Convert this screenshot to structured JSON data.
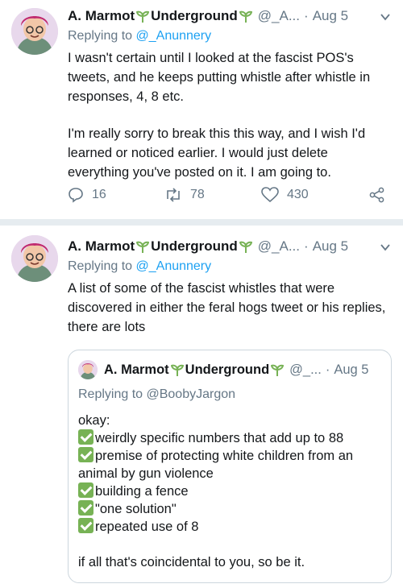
{
  "tweets": [
    {
      "author": {
        "name": "A. Marmot",
        "name_suffix": "Underground",
        "handle": "@_A...",
        "date": "Aug 5"
      },
      "reply_label": "Replying to",
      "reply_to": "@_Anunnery",
      "body": [
        "I wasn't certain until I looked at the fascist POS's tweets, and he keeps putting whistle after whistle in responses, 4, 8 etc.",
        "I'm really sorry to break this this way, and I wish I'd learned or noticed earlier.  I would just delete everything you've posted on it. I am going to."
      ],
      "stats": {
        "replies": "16",
        "retweets": "78",
        "likes": "430"
      }
    },
    {
      "author": {
        "name": "A. Marmot",
        "name_suffix": "Underground",
        "handle": "@_A...",
        "date": "Aug 5"
      },
      "reply_label": "Replying to",
      "reply_to": "@_Anunnery",
      "body": [
        "A list of some of the fascist whistles that were discovered in either the feral hogs tweet or his replies, there are lots"
      ],
      "quote": {
        "author": {
          "name": "A. Marmot",
          "name_suffix": "Underground",
          "handle": "@_...",
          "date": "Aug 5"
        },
        "reply_text": "Replying to @BoobyJargon",
        "intro": "okay:",
        "items": [
          "weirdly specific numbers that add up to 88",
          "premise of protecting white children from an animal by gun violence",
          "building a fence",
          "\"one solution\"",
          "repeated use of 8"
        ],
        "outro": "if all that's coincidental to you, so be it."
      }
    }
  ],
  "colors": {
    "accent": "#1da1f2",
    "secondary_text": "#657786",
    "check": "#77b255",
    "sprout": "#77b255",
    "divider": "#e6ecf0"
  },
  "icons": {
    "reply": "reply-icon",
    "retweet": "retweet-icon",
    "like": "heart-icon",
    "share": "share-icon",
    "caret": "chevron-down-icon",
    "sprout": "seedling-icon",
    "check": "check-mark-icon"
  }
}
